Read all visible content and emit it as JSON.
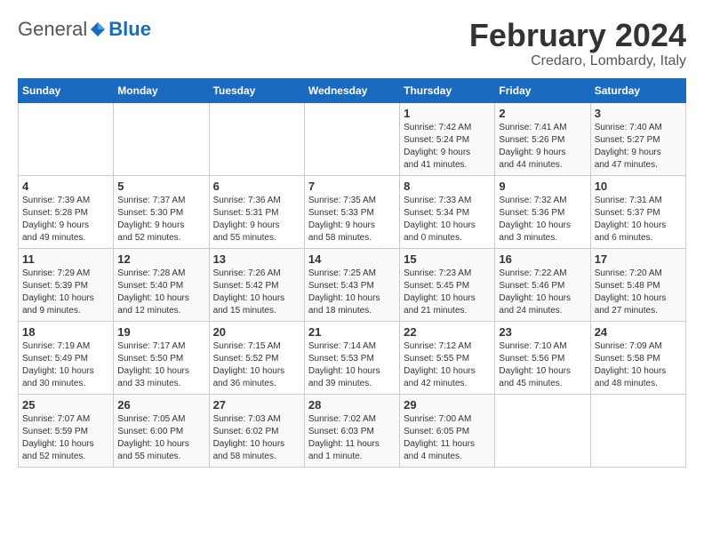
{
  "header": {
    "logo_general": "General",
    "logo_blue": "Blue",
    "month_title": "February 2024",
    "subtitle": "Credaro, Lombardy, Italy"
  },
  "weekdays": [
    "Sunday",
    "Monday",
    "Tuesday",
    "Wednesday",
    "Thursday",
    "Friday",
    "Saturday"
  ],
  "weeks": [
    [
      {
        "day": "",
        "info": ""
      },
      {
        "day": "",
        "info": ""
      },
      {
        "day": "",
        "info": ""
      },
      {
        "day": "",
        "info": ""
      },
      {
        "day": "1",
        "info": "Sunrise: 7:42 AM\nSunset: 5:24 PM\nDaylight: 9 hours\nand 41 minutes."
      },
      {
        "day": "2",
        "info": "Sunrise: 7:41 AM\nSunset: 5:26 PM\nDaylight: 9 hours\nand 44 minutes."
      },
      {
        "day": "3",
        "info": "Sunrise: 7:40 AM\nSunset: 5:27 PM\nDaylight: 9 hours\nand 47 minutes."
      }
    ],
    [
      {
        "day": "4",
        "info": "Sunrise: 7:39 AM\nSunset: 5:28 PM\nDaylight: 9 hours\nand 49 minutes."
      },
      {
        "day": "5",
        "info": "Sunrise: 7:37 AM\nSunset: 5:30 PM\nDaylight: 9 hours\nand 52 minutes."
      },
      {
        "day": "6",
        "info": "Sunrise: 7:36 AM\nSunset: 5:31 PM\nDaylight: 9 hours\nand 55 minutes."
      },
      {
        "day": "7",
        "info": "Sunrise: 7:35 AM\nSunset: 5:33 PM\nDaylight: 9 hours\nand 58 minutes."
      },
      {
        "day": "8",
        "info": "Sunrise: 7:33 AM\nSunset: 5:34 PM\nDaylight: 10 hours\nand 0 minutes."
      },
      {
        "day": "9",
        "info": "Sunrise: 7:32 AM\nSunset: 5:36 PM\nDaylight: 10 hours\nand 3 minutes."
      },
      {
        "day": "10",
        "info": "Sunrise: 7:31 AM\nSunset: 5:37 PM\nDaylight: 10 hours\nand 6 minutes."
      }
    ],
    [
      {
        "day": "11",
        "info": "Sunrise: 7:29 AM\nSunset: 5:39 PM\nDaylight: 10 hours\nand 9 minutes."
      },
      {
        "day": "12",
        "info": "Sunrise: 7:28 AM\nSunset: 5:40 PM\nDaylight: 10 hours\nand 12 minutes."
      },
      {
        "day": "13",
        "info": "Sunrise: 7:26 AM\nSunset: 5:42 PM\nDaylight: 10 hours\nand 15 minutes."
      },
      {
        "day": "14",
        "info": "Sunrise: 7:25 AM\nSunset: 5:43 PM\nDaylight: 10 hours\nand 18 minutes."
      },
      {
        "day": "15",
        "info": "Sunrise: 7:23 AM\nSunset: 5:45 PM\nDaylight: 10 hours\nand 21 minutes."
      },
      {
        "day": "16",
        "info": "Sunrise: 7:22 AM\nSunset: 5:46 PM\nDaylight: 10 hours\nand 24 minutes."
      },
      {
        "day": "17",
        "info": "Sunrise: 7:20 AM\nSunset: 5:48 PM\nDaylight: 10 hours\nand 27 minutes."
      }
    ],
    [
      {
        "day": "18",
        "info": "Sunrise: 7:19 AM\nSunset: 5:49 PM\nDaylight: 10 hours\nand 30 minutes."
      },
      {
        "day": "19",
        "info": "Sunrise: 7:17 AM\nSunset: 5:50 PM\nDaylight: 10 hours\nand 33 minutes."
      },
      {
        "day": "20",
        "info": "Sunrise: 7:15 AM\nSunset: 5:52 PM\nDaylight: 10 hours\nand 36 minutes."
      },
      {
        "day": "21",
        "info": "Sunrise: 7:14 AM\nSunset: 5:53 PM\nDaylight: 10 hours\nand 39 minutes."
      },
      {
        "day": "22",
        "info": "Sunrise: 7:12 AM\nSunset: 5:55 PM\nDaylight: 10 hours\nand 42 minutes."
      },
      {
        "day": "23",
        "info": "Sunrise: 7:10 AM\nSunset: 5:56 PM\nDaylight: 10 hours\nand 45 minutes."
      },
      {
        "day": "24",
        "info": "Sunrise: 7:09 AM\nSunset: 5:58 PM\nDaylight: 10 hours\nand 48 minutes."
      }
    ],
    [
      {
        "day": "25",
        "info": "Sunrise: 7:07 AM\nSunset: 5:59 PM\nDaylight: 10 hours\nand 52 minutes."
      },
      {
        "day": "26",
        "info": "Sunrise: 7:05 AM\nSunset: 6:00 PM\nDaylight: 10 hours\nand 55 minutes."
      },
      {
        "day": "27",
        "info": "Sunrise: 7:03 AM\nSunset: 6:02 PM\nDaylight: 10 hours\nand 58 minutes."
      },
      {
        "day": "28",
        "info": "Sunrise: 7:02 AM\nSunset: 6:03 PM\nDaylight: 11 hours\nand 1 minute."
      },
      {
        "day": "29",
        "info": "Sunrise: 7:00 AM\nSunset: 6:05 PM\nDaylight: 11 hours\nand 4 minutes."
      },
      {
        "day": "",
        "info": ""
      },
      {
        "day": "",
        "info": ""
      }
    ]
  ]
}
